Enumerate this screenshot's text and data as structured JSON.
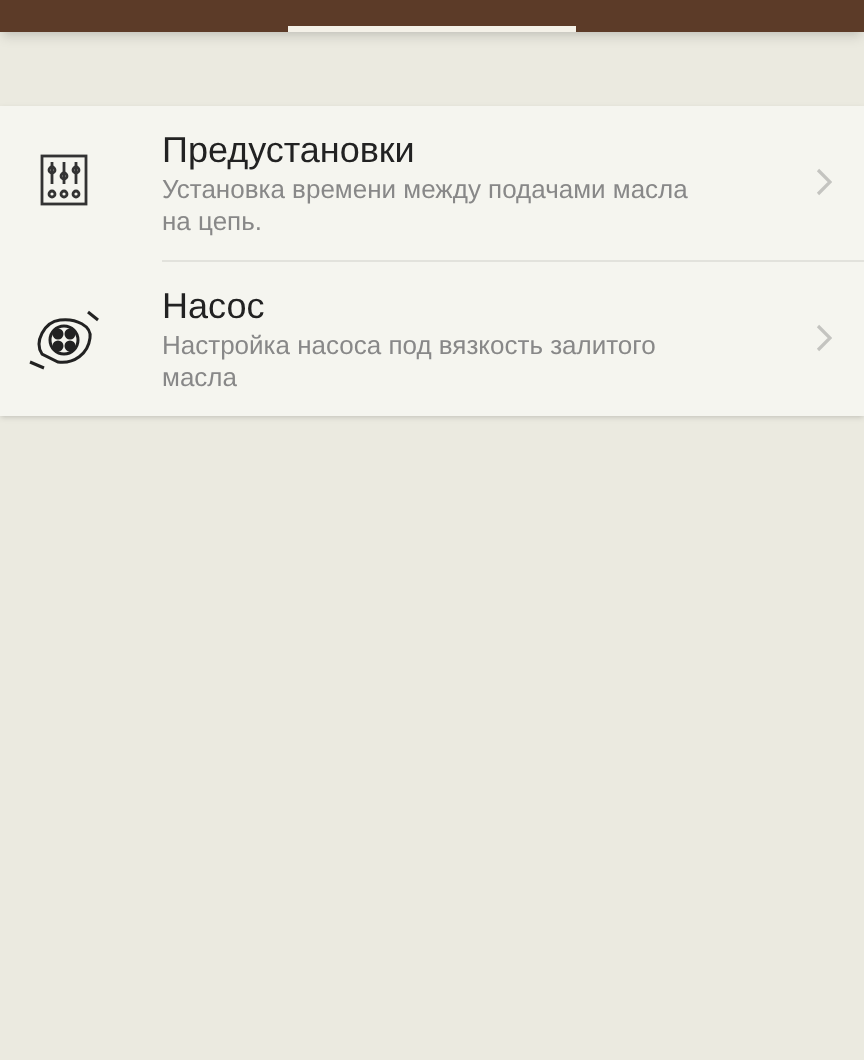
{
  "items": [
    {
      "kind": "sliders",
      "title": "Предустановки",
      "subtitle": "Установка времени между подачами масла на цепь."
    },
    {
      "kind": "pump",
      "title": "Насос",
      "subtitle": "Настройка насоса под вязкость залитого масла"
    }
  ]
}
